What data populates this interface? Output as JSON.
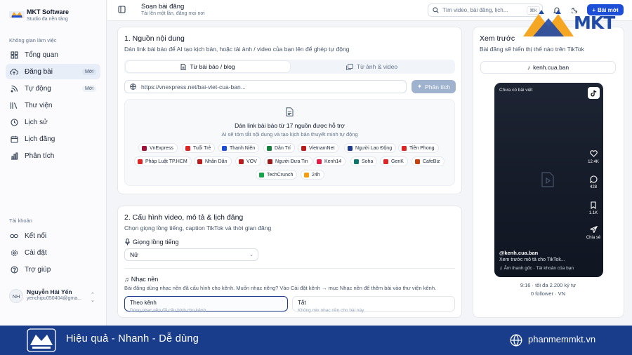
{
  "brand": {
    "name": "MKT Software",
    "tagline": "Studio đa nền tảng"
  },
  "sidebar": {
    "workspace_label": "Không gian làm việc",
    "items": [
      {
        "label": "Tổng quan",
        "icon": "grid-icon"
      },
      {
        "label": "Đăng bài",
        "icon": "cloud-upload-icon",
        "badge": "Mới",
        "active": true
      },
      {
        "label": "Tự động",
        "icon": "rss-icon",
        "badge": "Mới"
      },
      {
        "label": "Thư viện",
        "icon": "library-icon"
      },
      {
        "label": "Lịch sử",
        "icon": "clock-icon"
      },
      {
        "label": "Lịch đăng",
        "icon": "calendar-icon"
      },
      {
        "label": "Phân tích",
        "icon": "chart-icon"
      }
    ],
    "account_label": "Tài khoản",
    "account_items": [
      {
        "label": "Kết nối",
        "icon": "link-icon"
      },
      {
        "label": "Cài đặt",
        "icon": "gear-icon"
      },
      {
        "label": "Trợ giúp",
        "icon": "help-icon"
      }
    ],
    "user": {
      "initials": "NH",
      "name": "Nguyễn Hải Yến",
      "email": "yenchipu050404@gma..."
    }
  },
  "header": {
    "title": "Soạn bài đăng",
    "subtitle": "Tải lên một lần, đăng mọi nơi",
    "search_placeholder": "Tìm video, bài đăng, lịch...",
    "shortcut": "⌘K",
    "new_button": "Bài mới"
  },
  "source": {
    "title": "1. Nguồn nội dung",
    "description": "Dán link bài báo để AI tạo kịch bản, hoặc tải ảnh / video của bạn lên để ghép tự động",
    "tab_blog": "Từ bài báo / blog",
    "tab_media": "Từ ảnh & video",
    "url_placeholder": "https://vnexpress.net/bai-viet-cua-ban...",
    "analyze_button": "Phân tích",
    "drop_title": "Dán link bài báo từ 17 nguồn được hỗ trợ",
    "drop_subtitle": "AI sẽ tóm tắt nội dung và tạo kịch bản thuyết minh tự động",
    "sources": [
      {
        "name": "VnExpress",
        "color": "#9f1239"
      },
      {
        "name": "Tuổi Trẻ",
        "color": "#dc2626"
      },
      {
        "name": "Thanh Niên",
        "color": "#1d4ed8"
      },
      {
        "name": "Dân Trí",
        "color": "#15803d"
      },
      {
        "name": "VietnamNet",
        "color": "#b91c1c"
      },
      {
        "name": "Người Lao Động",
        "color": "#1e3a8a"
      },
      {
        "name": "Tiền Phong",
        "color": "#dc2626"
      },
      {
        "name": "Pháp Luật TP.HCM",
        "color": "#dc2626"
      },
      {
        "name": "Nhân Dân",
        "color": "#b91c1c"
      },
      {
        "name": "VOV",
        "color": "#b91c1c"
      },
      {
        "name": "Người Đưa Tin",
        "color": "#991b1b"
      },
      {
        "name": "Kenh14",
        "color": "#e11d48"
      },
      {
        "name": "Soha",
        "color": "#0f766e"
      },
      {
        "name": "GenK",
        "color": "#dc2626"
      },
      {
        "name": "CafeBiz",
        "color": "#c2410c"
      },
      {
        "name": "TechCrunch",
        "color": "#16a34a"
      },
      {
        "name": "24h",
        "color": "#f59e0b"
      }
    ]
  },
  "config": {
    "title": "2. Cấu hình video, mô tả & lịch đăng",
    "description": "Chọn giọng lồng tiếng, caption TikTok và thời gian đăng",
    "voice_label": "Giọng lồng tiếng",
    "voice_value": "Nữ",
    "music_label": "Nhạc nền",
    "music_description": "Bài đăng dùng nhạc nền đã cấu hình cho kênh. Muốn nhạc riêng? Vào Cài đặt kênh → mục Nhạc nền để thêm bài vào thư viện kênh.",
    "music_options": [
      {
        "title": "Theo kênh",
        "sub": "Dùng nhạc nền đã cấu hình cho kênh"
      },
      {
        "title": "Tắt",
        "sub": "Không mix nhạc nền cho bài này"
      }
    ]
  },
  "preview": {
    "title": "Xem trước",
    "description": "Bài đăng sẽ hiển thị thế nào trên TikTok",
    "account": "kenh.cua.ban",
    "empty_tag": "Chưa có bài viết",
    "likes": "12.4K",
    "comments": "428",
    "saves": "1.1K",
    "share": "Chia sẻ",
    "handle": "@kenh.cua.ban",
    "caption": "Xem trước mô tả cho TikTok...",
    "sound": "♫ Âm thanh gốc · Tài khoản của bạn",
    "ratio": "9:16 · tối đa 2.200 ký tự",
    "stats": "0 follower · VN"
  },
  "banner": {
    "slogan": "Hiệu quả - Nhanh - Dễ dùng",
    "site": "phanmemmkt.vn"
  },
  "watermark": {
    "text": "MKT"
  },
  "colors": {
    "primary": "#1d4ed8",
    "banner": "#1a3d8b",
    "accent_orange": "#f5a623"
  }
}
